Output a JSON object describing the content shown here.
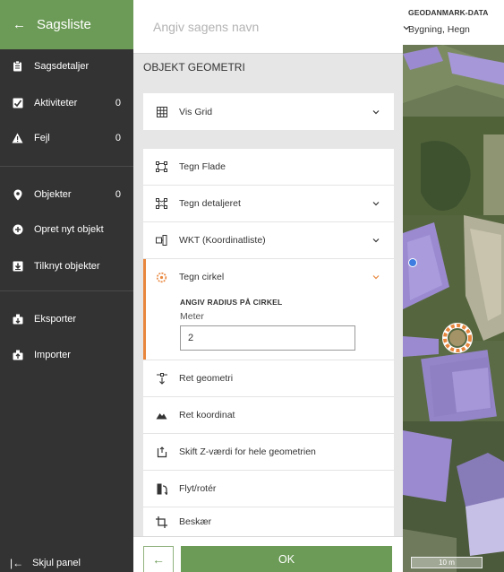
{
  "sidebar": {
    "title": "Sagsliste",
    "items": [
      {
        "label": "Sagsdetaljer",
        "count": "",
        "icon": "clipboard-icon"
      },
      {
        "label": "Aktiviteter",
        "count": "0",
        "icon": "checklist-icon"
      },
      {
        "label": "Fejl",
        "count": "0",
        "icon": "warning-icon"
      },
      {
        "label": "Objekter",
        "count": "0",
        "icon": "map-pin-icon"
      },
      {
        "label": "Opret nyt objekt",
        "count": "",
        "icon": "plus-circle-icon"
      },
      {
        "label": "Tilknyt objekter",
        "count": "",
        "icon": "download-box-icon"
      },
      {
        "label": "Eksporter",
        "count": "",
        "icon": "export-icon"
      },
      {
        "label": "Importer",
        "count": "",
        "icon": "import-icon"
      }
    ],
    "footer_label": "Skjul panel"
  },
  "main": {
    "name_placeholder": "Angiv sagens navn",
    "section_title": "OBJEKT GEOMETRI",
    "grid_label": "Vis Grid",
    "tools": [
      {
        "label": "Tegn Flade",
        "icon": "polygon-icon"
      },
      {
        "label": "Tegn detaljeret",
        "icon": "detailed-polygon-icon"
      },
      {
        "label": "WKT (Koordinatliste)",
        "icon": "coordinate-list-icon"
      },
      {
        "label": "Tegn cirkel",
        "icon": "circle-icon"
      }
    ],
    "circle": {
      "radius_label": "ANGIV RADIUS PÅ CIRKEL",
      "unit_label": "Meter",
      "radius_value": "2"
    },
    "actions": [
      {
        "label": "Ret geometri",
        "icon": "edit-vertex-icon"
      },
      {
        "label": "Ret koordinat",
        "icon": "mountain-icon"
      },
      {
        "label": "Skift Z-værdi for hele geometrien",
        "icon": "z-value-icon"
      },
      {
        "label": "Flyt/rotér",
        "icon": "move-rotate-icon"
      },
      {
        "label": "Beskær",
        "icon": "crop-icon"
      }
    ],
    "ok_label": "OK",
    "back_label": "←"
  },
  "map": {
    "source_title": "GEODANMARK-DATA",
    "layers_value": "Bygning, Hegn",
    "scale_label": "10 m"
  },
  "colors": {
    "brand_green": "#6b9b56",
    "sidebar_bg": "#333333",
    "active_orange": "#e8863d",
    "panel_bg": "#e6e6e6",
    "building_purple": "#9b8ad0"
  }
}
